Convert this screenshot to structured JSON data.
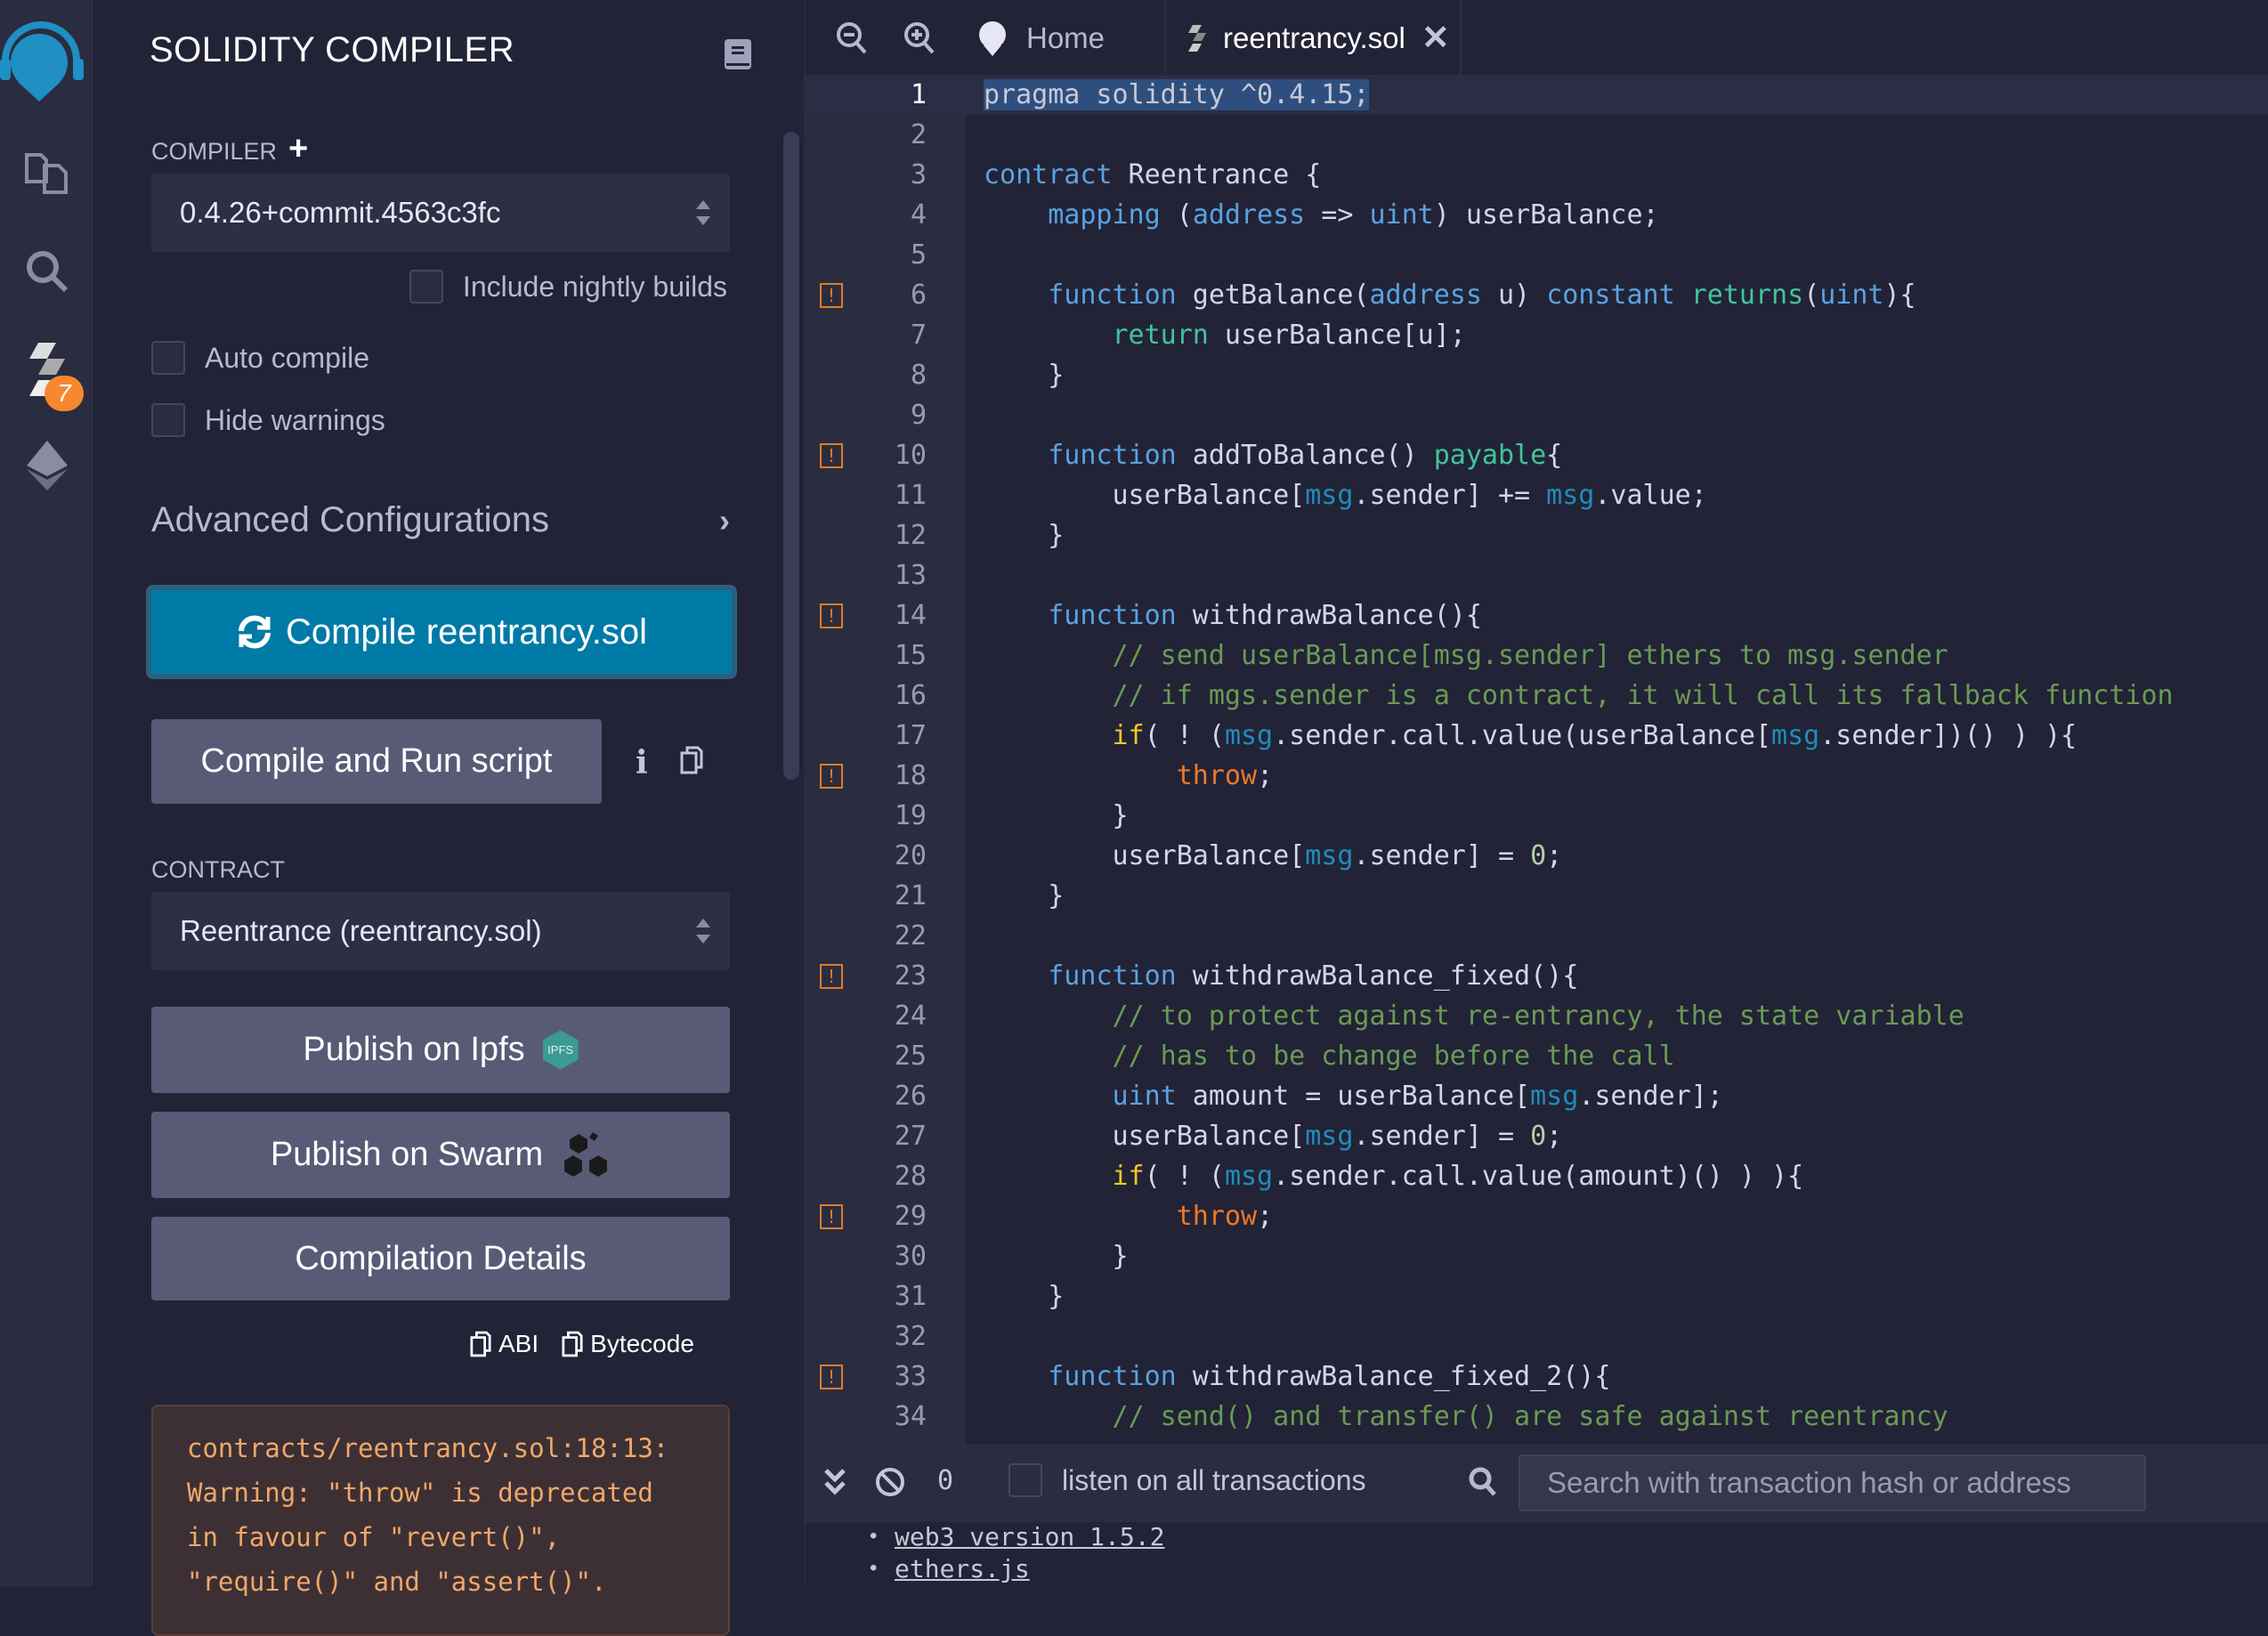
{
  "iconbar": {
    "items": [
      "remix-logo",
      "file-explorer",
      "search",
      "solidity-compiler",
      "deploy-run"
    ],
    "badge": "7"
  },
  "side": {
    "title": "SOLIDITY COMPILER",
    "compiler_label": "COMPILER",
    "compiler_version": "0.4.26+commit.4563c3fc",
    "nightly_label": "Include nightly builds",
    "auto_compile_label": "Auto compile",
    "hide_warnings_label": "Hide warnings",
    "advanced_label": "Advanced Configurations",
    "compile_button": "Compile reentrancy.sol",
    "compile_run_button": "Compile and Run script",
    "contract_label": "CONTRACT",
    "contract_value": "Reentrance (reentrancy.sol)",
    "publish_ipfs": "Publish on Ipfs",
    "ipfs_badge": "IPFS",
    "publish_swarm": "Publish on Swarm",
    "compilation_details": "Compilation Details",
    "abi_label": "ABI",
    "bytecode_label": "Bytecode",
    "warning_lines": [
      "contracts/reentrancy.sol:18:13:",
      "Warning: \"throw\" is deprecated",
      "in favour of \"revert()\",",
      "\"require()\" and \"assert()\"."
    ]
  },
  "tabs": {
    "home": "Home",
    "file": "reentrancy.sol"
  },
  "colors": {
    "accent": "#007aa6",
    "warning": "#e07b28",
    "keyword": "#5aa2e0",
    "comment": "#6a9a55"
  },
  "editor": {
    "warning_lines": [
      6,
      10,
      14,
      18,
      23,
      29,
      33
    ],
    "current_line": 1,
    "lines": [
      [
        [
          "sel",
          "pragma solidity ^0.4.15;"
        ]
      ],
      [],
      [
        [
          "k",
          "contract"
        ],
        [
          "t",
          " Reentrance {"
        ]
      ],
      [
        [
          "t",
          "    "
        ],
        [
          "k",
          "mapping"
        ],
        [
          "t",
          " ("
        ],
        [
          "k",
          "address"
        ],
        [
          "t",
          " => "
        ],
        [
          "k",
          "uint"
        ],
        [
          "t",
          ") userBalance;"
        ]
      ],
      [],
      [
        [
          "t",
          "    "
        ],
        [
          "k",
          "function"
        ],
        [
          "t",
          " getBalance("
        ],
        [
          "k",
          "address"
        ],
        [
          "t",
          " u) "
        ],
        [
          "k",
          "constant"
        ],
        [
          "t",
          " "
        ],
        [
          "g",
          "returns"
        ],
        [
          "t",
          "("
        ],
        [
          "k",
          "uint"
        ],
        [
          "t",
          "){"
        ]
      ],
      [
        [
          "t",
          "        "
        ],
        [
          "g",
          "return"
        ],
        [
          "t",
          " userBalance[u];"
        ]
      ],
      [
        [
          "t",
          "    }"
        ]
      ],
      [],
      [
        [
          "t",
          "    "
        ],
        [
          "k",
          "function"
        ],
        [
          "t",
          " addToBalance() "
        ],
        [
          "g",
          "payable"
        ],
        [
          "t",
          "{"
        ]
      ],
      [
        [
          "t",
          "        userBalance["
        ],
        [
          "m",
          "msg"
        ],
        [
          "t",
          ".sender] += "
        ],
        [
          "m",
          "msg"
        ],
        [
          "t",
          ".value;"
        ]
      ],
      [
        [
          "t",
          "    }"
        ]
      ],
      [],
      [
        [
          "t",
          "    "
        ],
        [
          "k",
          "function"
        ],
        [
          "t",
          " withdrawBalance(){"
        ]
      ],
      [
        [
          "t",
          "        "
        ],
        [
          "c",
          "// send userBalance[msg.sender] ethers to msg.sender"
        ]
      ],
      [
        [
          "t",
          "        "
        ],
        [
          "c",
          "// if mgs.sender is a contract, it will call its fallback function"
        ]
      ],
      [
        [
          "t",
          "        "
        ],
        [
          "y",
          "if"
        ],
        [
          "t",
          "( ! ("
        ],
        [
          "m",
          "msg"
        ],
        [
          "t",
          ".sender.call.value(userBalance["
        ],
        [
          "m",
          "msg"
        ],
        [
          "t",
          ".sender])() ) ){"
        ]
      ],
      [
        [
          "t",
          "            "
        ],
        [
          "o",
          "throw"
        ],
        [
          "t",
          ";"
        ]
      ],
      [
        [
          "t",
          "        }"
        ]
      ],
      [
        [
          "t",
          "        userBalance["
        ],
        [
          "m",
          "msg"
        ],
        [
          "t",
          ".sender] = "
        ],
        [
          "n",
          "0"
        ],
        [
          "t",
          ";"
        ]
      ],
      [
        [
          "t",
          "    }"
        ]
      ],
      [],
      [
        [
          "t",
          "    "
        ],
        [
          "k",
          "function"
        ],
        [
          "t",
          " withdrawBalance_fixed(){"
        ]
      ],
      [
        [
          "t",
          "        "
        ],
        [
          "c",
          "// to protect against re-entrancy, the state variable"
        ]
      ],
      [
        [
          "t",
          "        "
        ],
        [
          "c",
          "// has to be change before the call"
        ]
      ],
      [
        [
          "t",
          "        "
        ],
        [
          "k",
          "uint"
        ],
        [
          "t",
          " amount = userBalance["
        ],
        [
          "m",
          "msg"
        ],
        [
          "t",
          ".sender];"
        ]
      ],
      [
        [
          "t",
          "        userBalance["
        ],
        [
          "m",
          "msg"
        ],
        [
          "t",
          ".sender] = "
        ],
        [
          "n",
          "0"
        ],
        [
          "t",
          ";"
        ]
      ],
      [
        [
          "t",
          "        "
        ],
        [
          "y",
          "if"
        ],
        [
          "t",
          "( ! ("
        ],
        [
          "m",
          "msg"
        ],
        [
          "t",
          ".sender.call.value(amount)() ) ){"
        ]
      ],
      [
        [
          "t",
          "            "
        ],
        [
          "o",
          "throw"
        ],
        [
          "t",
          ";"
        ]
      ],
      [
        [
          "t",
          "        }"
        ]
      ],
      [
        [
          "t",
          "    }"
        ]
      ],
      [],
      [
        [
          "t",
          "    "
        ],
        [
          "k",
          "function"
        ],
        [
          "t",
          " withdrawBalance_fixed_2(){"
        ]
      ],
      [
        [
          "t",
          "        "
        ],
        [
          "c",
          "// send() and transfer() are safe against reentrancy"
        ]
      ]
    ]
  },
  "terminal": {
    "pending_count": "0",
    "listen_label": "listen on all transactions",
    "search_placeholder": "Search with transaction hash or address",
    "links": [
      "web3 version 1.5.2",
      "ethers.js"
    ]
  }
}
